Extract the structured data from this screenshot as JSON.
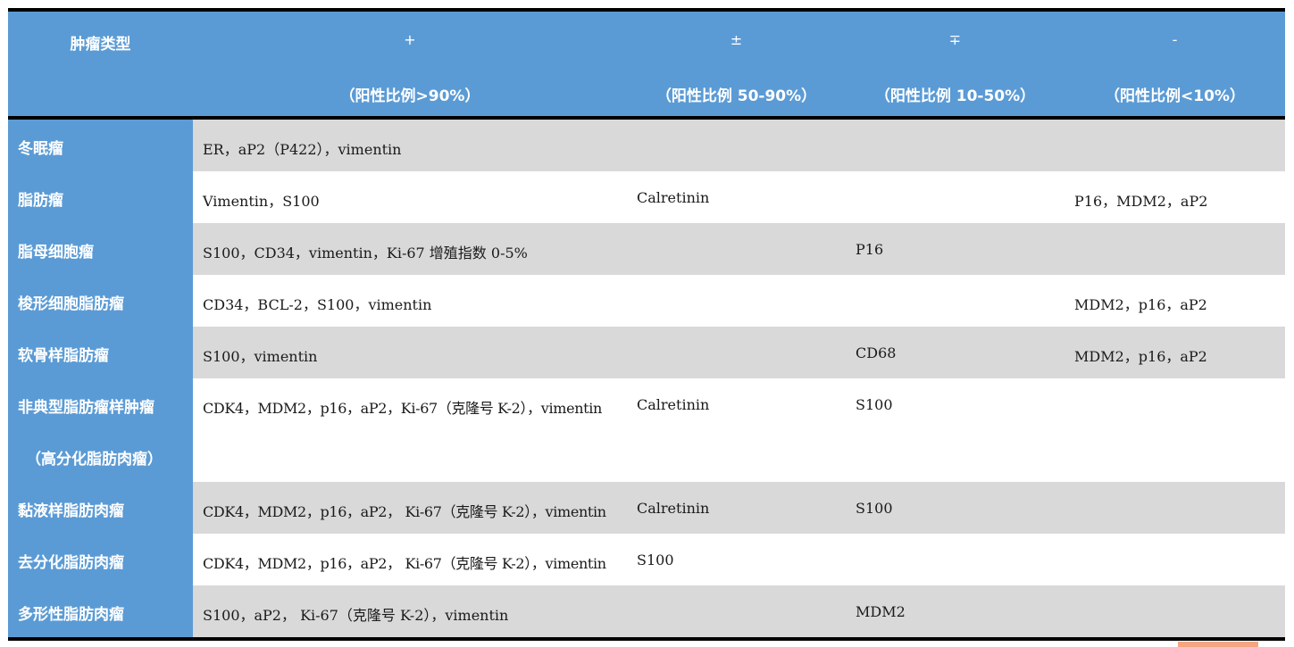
{
  "header": {
    "type_label": "肿瘤类型",
    "columns": [
      {
        "symbol": "+",
        "range": "（阳性比例>90%）"
      },
      {
        "symbol": "±",
        "range": "（阳性比例 50-90%）"
      },
      {
        "symbol": "∓",
        "range": "（阳性比例 10-50%）"
      },
      {
        "symbol": "-",
        "range": "（阳性比例<10%）"
      }
    ]
  },
  "rows": [
    {
      "name": "冬眠瘤",
      "name2": "",
      "c1": "ER，aP2（P422），vimentin",
      "c2": "",
      "c3": "",
      "c4": ""
    },
    {
      "name": "脂肪瘤",
      "name2": "",
      "c1": "Vimentin，S100",
      "c2": "Calretinin",
      "c3": "",
      "c4": "P16，MDM2，aP2"
    },
    {
      "name": "脂母细胞瘤",
      "name2": "",
      "c1": "S100，CD34，vimentin，Ki-67 增殖指数 0-5%",
      "c2": "",
      "c3": "P16",
      "c4": ""
    },
    {
      "name": "梭形细胞脂肪瘤",
      "name2": "",
      "c1": "CD34，BCL-2，S100，vimentin",
      "c2": "",
      "c3": "",
      "c4": "MDM2，p16，aP2"
    },
    {
      "name": "软骨样脂肪瘤",
      "name2": "",
      "c1": "S100，vimentin",
      "c2": "",
      "c3": "CD68",
      "c4": "MDM2，p16，aP2"
    },
    {
      "name": "非典型脂肪瘤样肿瘤",
      "name2": "（高分化脂肪肉瘤）",
      "c1": "CDK4，MDM2，p16，aP2，Ki-67（克隆号 K-2），vimentin",
      "c2": "Calretinin",
      "c3": "S100",
      "c4": ""
    },
    {
      "name": "黏液样脂肪肉瘤",
      "name2": "",
      "c1": "CDK4，MDM2，p16，aP2， Ki-67（克隆号 K-2），vimentin",
      "c2": "Calretinin",
      "c3": "S100",
      "c4": ""
    },
    {
      "name": "去分化脂肪肉瘤",
      "name2": "",
      "c1": "CDK4，MDM2，p16，aP2， Ki-67（克隆号 K-2），vimentin",
      "c2": "S100",
      "c3": "",
      "c4": ""
    },
    {
      "name": "多形性脂肪肉瘤",
      "name2": "",
      "c1": "S100，aP2， Ki-67（克隆号 K-2），vimentin",
      "c2": "",
      "c3": "MDM2",
      "c4": ""
    }
  ]
}
